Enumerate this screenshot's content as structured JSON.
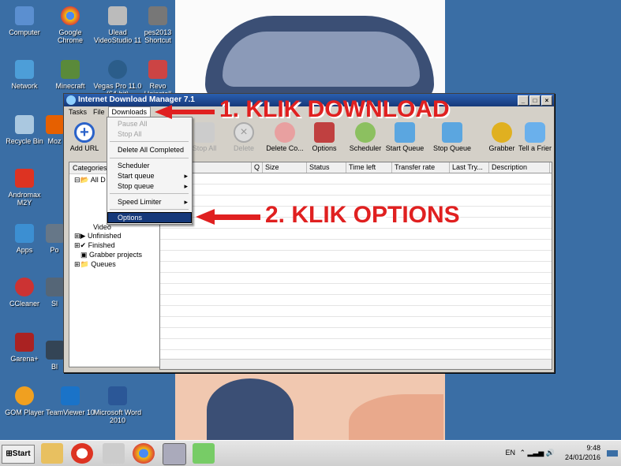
{
  "desktop_icons": [
    {
      "label": "Computer"
    },
    {
      "label": "Google Chrome"
    },
    {
      "label": "Ulead VideoStudio 11"
    },
    {
      "label": "pes2013 Shortcut"
    },
    {
      "label": "Network"
    },
    {
      "label": "Minecraft"
    },
    {
      "label": "Vegas Pro 11.0 (64-bit)"
    },
    {
      "label": "Revo Uninstall"
    },
    {
      "label": "Recycle Bin"
    },
    {
      "label": "Moz"
    },
    {
      "label": "Andromax M2Y"
    },
    {
      "label": "Apps"
    },
    {
      "label": "Po"
    },
    {
      "label": "CCleaner"
    },
    {
      "label": "Sl"
    },
    {
      "label": "Garena+"
    },
    {
      "label": "Bl"
    },
    {
      "label": "GOM Player"
    },
    {
      "label": "TeamViewer 10"
    },
    {
      "label": "Microsoft Word 2010"
    }
  ],
  "window": {
    "title": "Internet Download Manager 7.1",
    "controls": {
      "minimize": "_",
      "maximize": "□",
      "close": "×"
    }
  },
  "menubar": {
    "tasks": "Tasks",
    "file": "File",
    "downloads": "Downloads"
  },
  "toolbar": [
    {
      "label": "Add URL",
      "icon": "add-url-icon",
      "enabled": true
    },
    {
      "label": "Stop All",
      "icon": "stop-all-icon",
      "enabled": false
    },
    {
      "label": "Delete",
      "icon": "delete-icon",
      "enabled": false
    },
    {
      "label": "Delete Co...",
      "icon": "delete-completed-icon",
      "enabled": true
    },
    {
      "label": "Options",
      "icon": "options-icon",
      "enabled": true
    },
    {
      "label": "Scheduler",
      "icon": "scheduler-icon",
      "enabled": true
    },
    {
      "label": "Start Queue",
      "icon": "start-queue-icon",
      "enabled": true
    },
    {
      "label": "Stop Queue",
      "icon": "stop-queue-icon",
      "enabled": true
    },
    {
      "label": "Grabber",
      "icon": "grabber-icon",
      "enabled": true
    },
    {
      "label": "Tell a Frier",
      "icon": "tell-friend-icon",
      "enabled": true
    }
  ],
  "categories": {
    "header": "Categories",
    "tree": [
      "All D",
      "Video",
      "Unfinished",
      "Finished",
      "Grabber projects",
      "Queues"
    ]
  },
  "columns": [
    "Q",
    "Size",
    "Status",
    "Time left",
    "Transfer rate",
    "Last Try...",
    "Description"
  ],
  "downloads_menu": {
    "pause_all": "Pause All",
    "stop_all": "Stop All",
    "delete_all_completed": "Delete All Completed",
    "scheduler": "Scheduler",
    "start_queue": "Start queue",
    "stop_queue": "Stop queue",
    "speed_limiter": "Speed Limiter",
    "options": "Options"
  },
  "annotations": {
    "step1": "1. KLIK DOWNLOAD",
    "step2": "2. KLIK OPTIONS"
  },
  "taskbar": {
    "start": "Start",
    "language": "EN",
    "time": "9:48",
    "date": "24/01/2016"
  },
  "colors": {
    "title_bar": "#16397a",
    "annotation": "#e02020",
    "desktop": "#3a6ea5"
  }
}
